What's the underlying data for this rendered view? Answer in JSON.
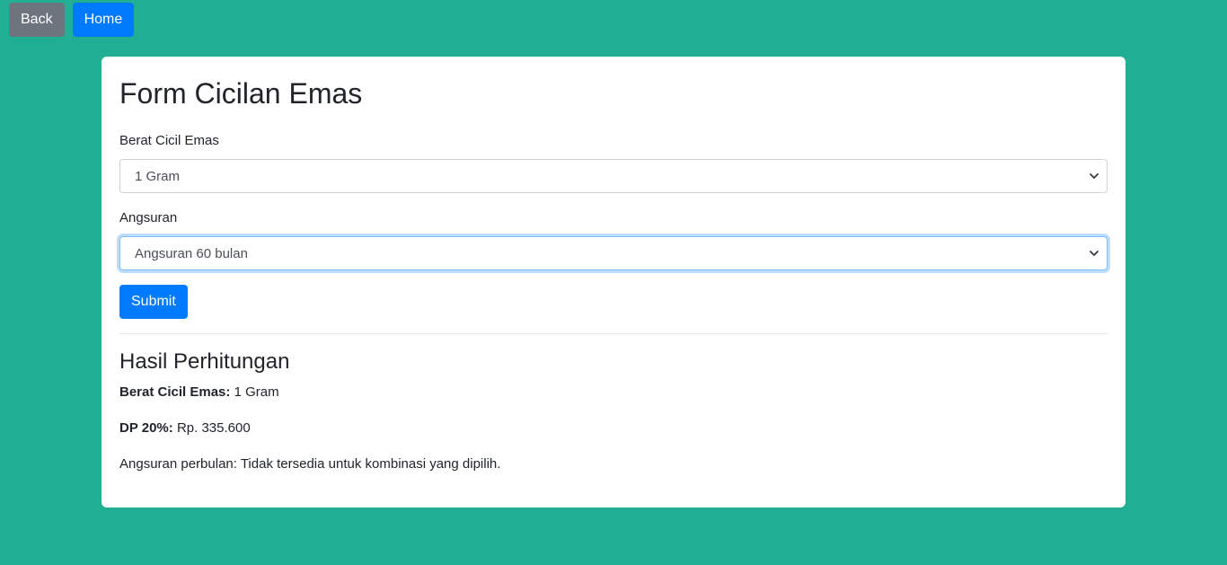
{
  "nav": {
    "back_label": "Back",
    "home_label": "Home"
  },
  "form": {
    "title": "Form Cicilan Emas",
    "weight_label": "Berat Cicil Emas",
    "weight_value": "1 Gram",
    "installment_label": "Angsuran",
    "installment_value": "Angsuran 60 bulan",
    "submit_label": "Submit"
  },
  "result": {
    "title": "Hasil Perhitungan",
    "weight_key": "Berat Cicil Emas:",
    "weight_value": "1 Gram",
    "dp_key": "DP 20%:",
    "dp_value": "Rp. 335.600",
    "monthly_text": "Angsuran perbulan: Tidak tersedia untuk kombinasi yang dipilih."
  },
  "colors": {
    "background": "#20ae94",
    "primary": "#007bff",
    "secondary": "#6c757d"
  },
  "icons": {
    "select_arrow": "chevron-down-icon"
  }
}
